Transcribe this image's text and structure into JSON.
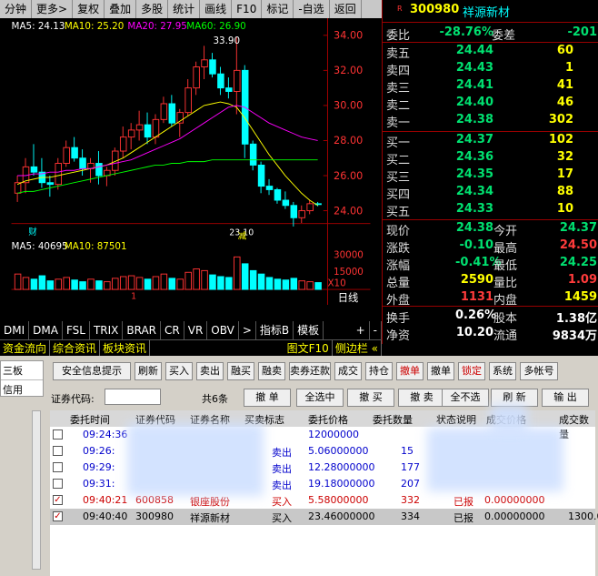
{
  "toolbar": {
    "items": [
      "分钟",
      "更多>",
      "复权",
      "叠加",
      "多股",
      "统计",
      "画线",
      "F10",
      "标记",
      "-自选",
      "返回"
    ]
  },
  "chart": {
    "ma_legend": {
      "ma5": "MA5: 24.13",
      "ma10": "MA10: 25.20",
      "ma20": "MA20: 27.95",
      "ma60": "MA60: 26.90"
    },
    "price_ticks": [
      "34.00",
      "32.00",
      "30.00",
      "28.00",
      "26.00",
      "24.00"
    ],
    "high_label": "33.90",
    "low_label": "23.10",
    "vol_legend": {
      "ma5": "MA5: 40695",
      "ma10": "MA10: 87501"
    },
    "vol_ticks": [
      "30000",
      "15000",
      "X10"
    ],
    "markers": {
      "cai": "财",
      "jian": "减",
      "one": "1"
    },
    "period": "日线",
    "plus": "+",
    "minus": "-"
  },
  "indicators": [
    "DMI",
    "DMA",
    "FSL",
    "TRIX",
    "BRAR",
    "CR",
    "VR",
    "OBV",
    ">",
    "指标B",
    "模板"
  ],
  "infobar": {
    "items": [
      "资金流向",
      "综合资讯",
      "板块资讯"
    ],
    "right": [
      "图文F10",
      "侧边栏 «"
    ]
  },
  "quote": {
    "code": "300980",
    "name": "祥源新材",
    "webi": {
      "label": "委比",
      "value": "-28.76%",
      "label2": "委差",
      "value2": "-201"
    },
    "asks": [
      {
        "label": "卖五",
        "price": "24.44",
        "vol": "60"
      },
      {
        "label": "卖四",
        "price": "24.43",
        "vol": "1"
      },
      {
        "label": "卖三",
        "price": "24.41",
        "vol": "41"
      },
      {
        "label": "卖二",
        "price": "24.40",
        "vol": "46"
      },
      {
        "label": "卖一",
        "price": "24.38",
        "vol": "302"
      }
    ],
    "bids": [
      {
        "label": "买一",
        "price": "24.37",
        "vol": "102"
      },
      {
        "label": "买二",
        "price": "24.36",
        "vol": "32"
      },
      {
        "label": "买三",
        "price": "24.35",
        "vol": "17"
      },
      {
        "label": "买四",
        "price": "24.34",
        "vol": "88"
      },
      {
        "label": "买五",
        "price": "24.33",
        "vol": "10"
      }
    ],
    "stats": [
      {
        "l1": "现价",
        "v1": "24.38",
        "l2": "今开",
        "v2": "24.37"
      },
      {
        "l1": "涨跌",
        "v1": "-0.10",
        "l2": "最高",
        "v2": "24.50"
      },
      {
        "l1": "涨幅",
        "v1": "-0.41%",
        "l2": "最低",
        "v2": "24.25"
      },
      {
        "l1": "总量",
        "v1": "2590",
        "l2": "量比",
        "v2": "1.09"
      },
      {
        "l1": "外盘",
        "v1": "1131",
        "l2": "内盘",
        "v2": "1459"
      }
    ],
    "extra": [
      {
        "l1": "换手",
        "v1": "0.26%",
        "l2": "股本",
        "v2": "1.38亿"
      },
      {
        "l1": "净资",
        "v1": "10.20",
        "l2": "流通",
        "v2": "9834万"
      }
    ]
  },
  "trade": {
    "left_tabs": [
      "三板",
      "信用"
    ],
    "buttons": [
      "安全信息提示",
      "刷新",
      "买入",
      "卖出",
      "融买",
      "融卖",
      "卖券还款",
      "成交",
      "持仓",
      "撤单",
      "撤单",
      "锁定",
      "系统",
      "多帐号"
    ],
    "code_label": "证券代码:",
    "count": "共6条",
    "actions": [
      "撤 单",
      "全选中",
      "撤 买",
      "撤 卖",
      "全不选",
      "刷 新",
      "输 出"
    ],
    "headers": [
      "委托时间",
      "证券代码",
      "证券名称",
      "买卖标志",
      "委托价格",
      "委托数量",
      "状态说明",
      "成交价格",
      "成交数量"
    ],
    "rows": [
      {
        "time": "09:24:36",
        "code": "",
        "name": "",
        "side": "",
        "price": "12000000",
        "qty": "",
        "status": "",
        "dprice": "",
        "dqty": "",
        "checked": false
      },
      {
        "time": "09:26:",
        "code": "",
        "name": "",
        "side": "卖出",
        "price": "5.06000000",
        "qty": "15",
        "status": "",
        "dprice": "",
        "dqty": "",
        "checked": false
      },
      {
        "time": "09:29:",
        "code": "",
        "name": "",
        "side": "卖出",
        "price": "12.28000000",
        "qty": "177",
        "status": "",
        "dprice": "",
        "dqty": "",
        "checked": false
      },
      {
        "time": "09:31:",
        "code": "",
        "name": "",
        "side": "卖出",
        "price": "19.18000000",
        "qty": "207",
        "status": "",
        "dprice": "",
        "dqty": "",
        "checked": false
      },
      {
        "time": "09:40:21",
        "code": "600858",
        "name": "银座股份",
        "side": "买入",
        "price": "5.58000000",
        "qty": "332",
        "status": "已报",
        "dprice": "0.00000000",
        "dqty": "",
        "checked": true
      },
      {
        "time": "09:40:40",
        "code": "300980",
        "name": "祥源新材",
        "side": "买入",
        "price": "23.46000000",
        "qty": "334",
        "status": "已报",
        "dprice": "0.00000000",
        "dqty": "1300.0",
        "checked": true
      }
    ]
  }
}
